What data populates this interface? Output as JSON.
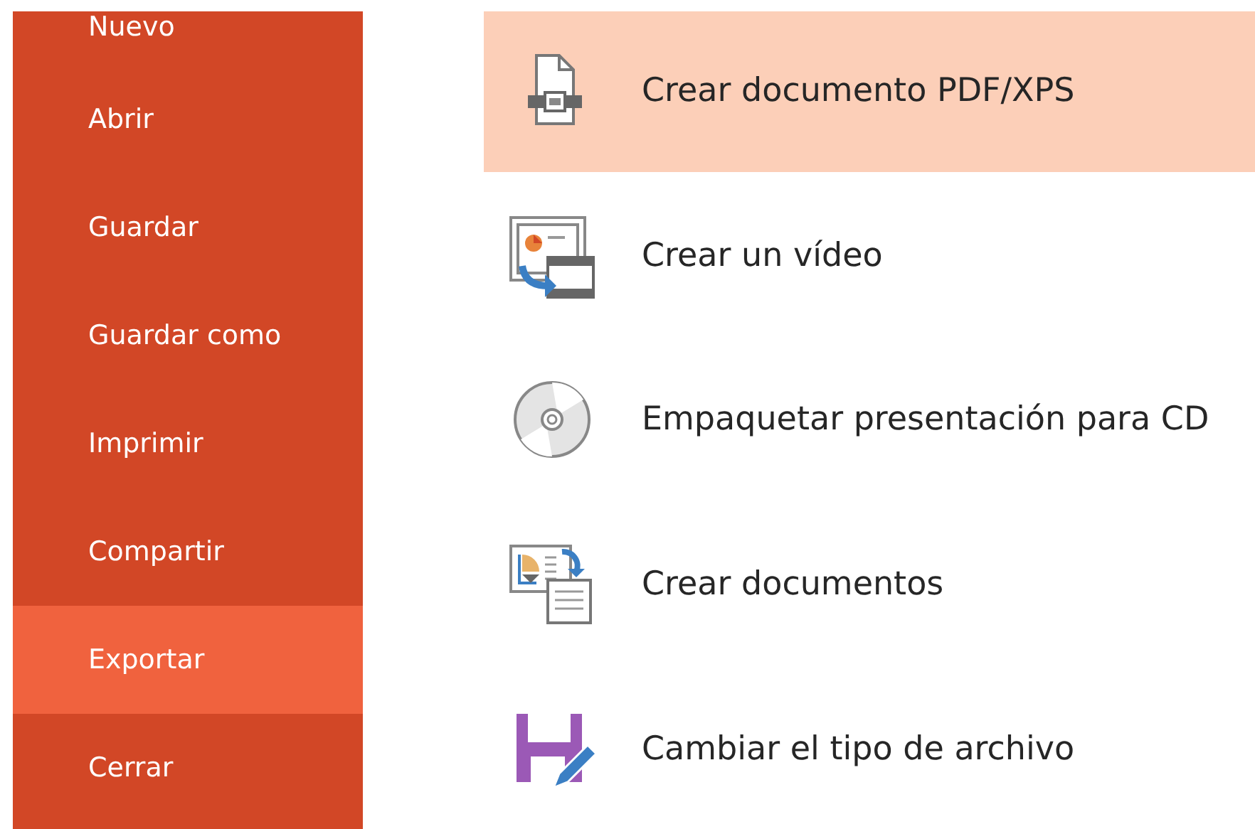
{
  "sidebar": {
    "items": [
      {
        "label": "Nuevo",
        "selected": false
      },
      {
        "label": "Abrir",
        "selected": false
      },
      {
        "label": "Guardar",
        "selected": false
      },
      {
        "label": "Guardar como",
        "selected": false
      },
      {
        "label": "Imprimir",
        "selected": false
      },
      {
        "label": "Compartir",
        "selected": false
      },
      {
        "label": "Exportar",
        "selected": true
      },
      {
        "label": "Cerrar",
        "selected": false
      }
    ]
  },
  "export_options": [
    {
      "kind": "pdf",
      "label": "Crear documento PDF/XPS",
      "selected": true
    },
    {
      "kind": "video",
      "label": "Crear un vídeo",
      "selected": false
    },
    {
      "kind": "cd",
      "label": "Empaquetar presentación para CD",
      "selected": false
    },
    {
      "kind": "handouts",
      "label": "Crear documentos",
      "selected": false
    },
    {
      "kind": "filetype",
      "label": "Cambiar el tipo de archivo",
      "selected": false
    }
  ]
}
